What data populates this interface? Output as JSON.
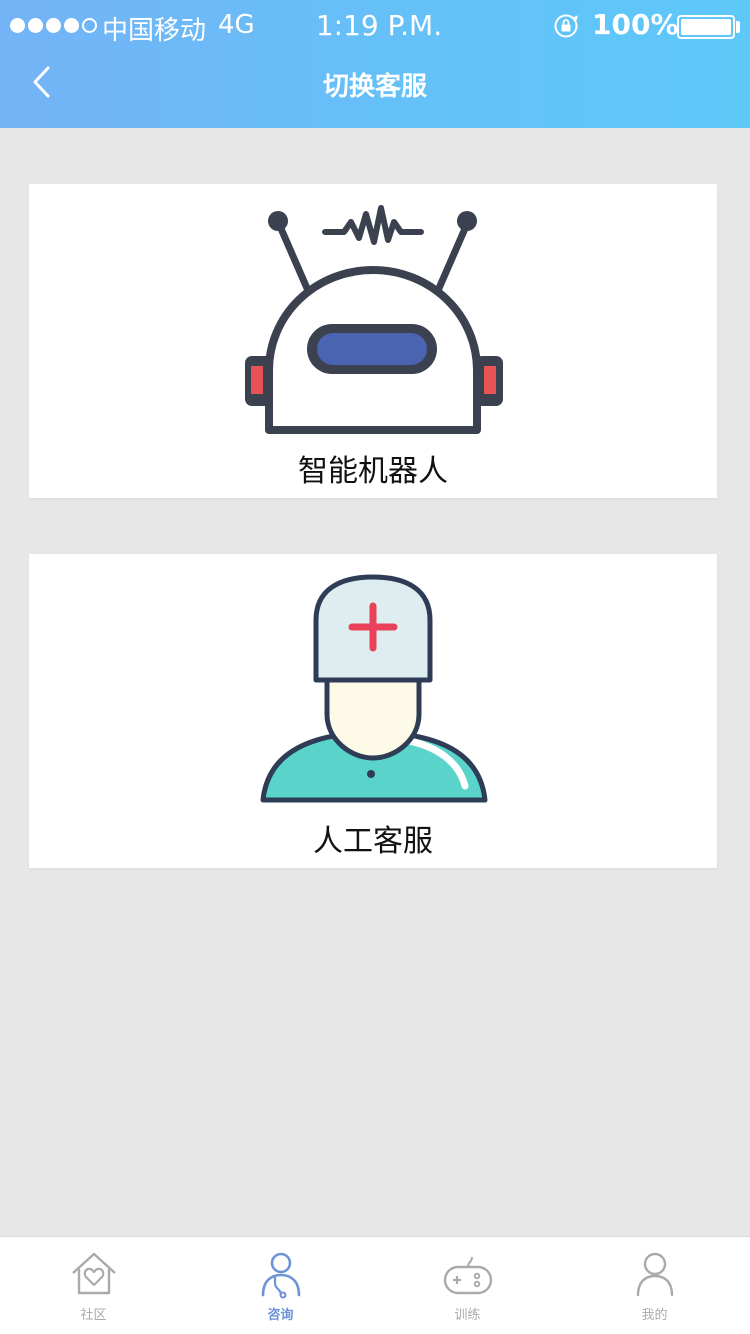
{
  "status_bar": {
    "carrier": "中国移动",
    "network": "4G",
    "time": "1:19 P.M.",
    "battery": "100%",
    "signal_bars_filled": 4,
    "signal_bars_total": 5
  },
  "header": {
    "title": "切换客服",
    "back_icon": "chevron-left-icon"
  },
  "options": [
    {
      "label": "智能机器人",
      "icon": "robot-icon"
    },
    {
      "label": "人工客服",
      "icon": "doctor-icon"
    }
  ],
  "tabbar": {
    "items": [
      {
        "label": "社区",
        "icon": "home-heart-icon",
        "active": false
      },
      {
        "label": "咨询",
        "icon": "stethoscope-person-icon",
        "active": true
      },
      {
        "label": "训练",
        "icon": "gamepad-icon",
        "active": false
      },
      {
        "label": "我的",
        "icon": "user-icon",
        "active": false
      }
    ]
  },
  "colors": {
    "header_start": "#74b3f6",
    "header_end": "#5ec8f9",
    "background": "#e7e7e7",
    "tab_active": "#6d93d8",
    "tab_inactive": "#aaaaaa"
  }
}
